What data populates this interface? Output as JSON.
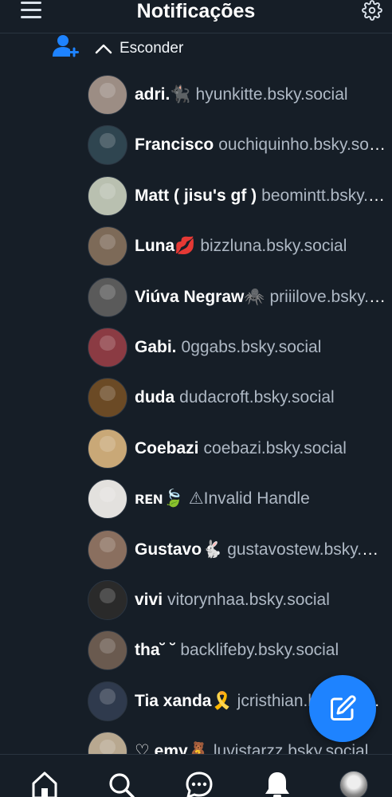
{
  "header": {
    "title": "Notificações",
    "menu_icon": "hamburger-menu-icon",
    "settings_icon": "gear-icon"
  },
  "follow_group": {
    "icon": "user-plus-icon",
    "toggle_label": "Esconder",
    "toggle_icon": "chevron-up-icon"
  },
  "users": [
    {
      "name": "adri.",
      "emoji": "🐈‍⬛",
      "handle": "hyunkitte.bsky.social",
      "avatar_color": "#9c8d84"
    },
    {
      "name": "Francisco",
      "emoji": "",
      "handle": "ouchiquinho.bsky.social",
      "avatar_color": "#2f4550"
    },
    {
      "name": "Matt ( jisu's gf )",
      "emoji": "",
      "handle": "beomintt.bsky.social",
      "avatar_color": "#b9c0b0"
    },
    {
      "name": "Luna",
      "emoji": "💋",
      "handle": "bizzluna.bsky.social",
      "avatar_color": "#7d6a58"
    },
    {
      "name": "Viúva Negraw",
      "emoji": "🕷️",
      "handle": "priiilove.bsky.social",
      "avatar_color": "#5a5a5a"
    },
    {
      "name": "Gabi.",
      "emoji": "",
      "handle": "0ggabs.bsky.social",
      "avatar_color": "#8b3b43"
    },
    {
      "name": "duda",
      "emoji": "",
      "handle": "dudacroft.bsky.social",
      "avatar_color": "#6b4a25"
    },
    {
      "name": "Coebazi",
      "emoji": "",
      "handle": "coebazi.bsky.social",
      "avatar_color": "#c9a877"
    },
    {
      "name": "ʀᴇɴ",
      "emoji": "🍃",
      "handle": "⚠Invalid Handle",
      "avatar_color": "#e3e1de"
    },
    {
      "name": "Gustavo",
      "emoji": "🐇",
      "handle": "gustavostew.bsky.social",
      "avatar_color": "#8a6f5f"
    },
    {
      "name": "vivi",
      "emoji": "",
      "handle": "vitorynhaa.bsky.social",
      "avatar_color": "#2a2a2a"
    },
    {
      "name": "tha",
      "emoji": "˘ ˘",
      "handle": "backlifeby.bsky.social",
      "avatar_color": "#6a5a4f"
    },
    {
      "name": "Tia xanda",
      "emoji": "🎗️",
      "handle": "jcristhian.bsky.social",
      "avatar_color": "#2f3a4d"
    },
    {
      "name": "♡ emy",
      "emoji": "🧸",
      "handle": "luvistarzz.bsky.social",
      "avatar_color": "#b8a890"
    }
  ],
  "fab": {
    "icon": "compose-pencil-icon"
  },
  "bottom_nav": {
    "items": [
      "home-icon",
      "search-icon",
      "chat-icon",
      "bell-icon",
      "profile-avatar"
    ]
  },
  "colors": {
    "background": "#161e27",
    "accent": "#1e83ff",
    "handle_text": "#aeb8c4"
  }
}
